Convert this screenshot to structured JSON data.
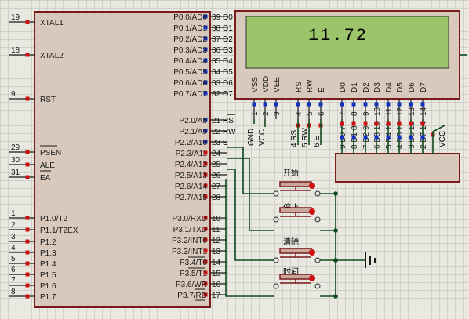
{
  "lcd": {
    "display_text": "11.72"
  },
  "mcu": {
    "left_pins": [
      {
        "num": "19",
        "name": "XTAL1"
      },
      {
        "num": "18",
        "name": "XTAL2"
      },
      {
        "num": "9",
        "name": "RST"
      },
      {
        "num": "29",
        "name": "PSEN"
      },
      {
        "num": "30",
        "name": "ALE"
      },
      {
        "num": "31",
        "name": "EA"
      },
      {
        "num": "1",
        "name": "P1.0/T2"
      },
      {
        "num": "2",
        "name": "P1.1/T2EX"
      },
      {
        "num": "3",
        "name": "P1.2"
      },
      {
        "num": "4",
        "name": "P1.3"
      },
      {
        "num": "5",
        "name": "P1.4"
      },
      {
        "num": "6",
        "name": "P1.5"
      },
      {
        "num": "7",
        "name": "P1.6"
      },
      {
        "num": "8",
        "name": "P1.7"
      }
    ],
    "right_pins": [
      {
        "num": "39",
        "name": "P0.0/AD0",
        "net": "D0"
      },
      {
        "num": "38",
        "name": "P0.1/AD1",
        "net": "D1"
      },
      {
        "num": "37",
        "name": "P0.2/AD2",
        "net": "D2"
      },
      {
        "num": "36",
        "name": "P0.3/AD3",
        "net": "D3"
      },
      {
        "num": "35",
        "name": "P0.4/AD4",
        "net": "D4"
      },
      {
        "num": "34",
        "name": "P0.5/AD5",
        "net": "D5"
      },
      {
        "num": "33",
        "name": "P0.6/AD6",
        "net": "D6"
      },
      {
        "num": "32",
        "name": "P0.7/AD7",
        "net": "D7"
      },
      {
        "num": "21",
        "name": "P2.0/A8",
        "net": "RS"
      },
      {
        "num": "22",
        "name": "P2.1/A9",
        "net": "RW"
      },
      {
        "num": "23",
        "name": "P2.2/A10",
        "net": "E"
      },
      {
        "num": "24",
        "name": "P2.3/A11",
        "net": ""
      },
      {
        "num": "25",
        "name": "P2.4/A12",
        "net": ""
      },
      {
        "num": "26",
        "name": "P2.5/A13",
        "net": ""
      },
      {
        "num": "27",
        "name": "P2.6/A14",
        "net": ""
      },
      {
        "num": "28",
        "name": "P2.7/A15",
        "net": ""
      },
      {
        "num": "10",
        "name": "P3.0/RXD",
        "net": ""
      },
      {
        "num": "11",
        "name": "P3.1/TXD",
        "net": ""
      },
      {
        "num": "12",
        "name": "P3.2/INT0",
        "net": ""
      },
      {
        "num": "13",
        "name": "P3.3/INT1",
        "net": ""
      },
      {
        "num": "14",
        "name": "P3.4/T0",
        "net": ""
      },
      {
        "num": "15",
        "name": "P3.5/T1",
        "net": ""
      },
      {
        "num": "16",
        "name": "P3.6/WR",
        "net": ""
      },
      {
        "num": "17",
        "name": "P3.7/RD",
        "net": ""
      }
    ]
  },
  "lcd_pins": {
    "names": [
      "VSS",
      "VDD",
      "VEE",
      "RS",
      "RW",
      "E",
      "D0",
      "D1",
      "D2",
      "D3",
      "D4",
      "D5",
      "D6",
      "D7"
    ],
    "numbers": [
      "1",
      "2",
      "3",
      "4",
      "5",
      "6",
      "7",
      "8",
      "9",
      "10",
      "11",
      "12",
      "13",
      "14"
    ]
  },
  "lcd_connections": {
    "gnd": "GND",
    "vcc": "VCC",
    "rs": "RS",
    "rw": "RW",
    "e": "E",
    "rs_num": "4",
    "rw_num": "5",
    "e_num": "6"
  },
  "resistor_pack": {
    "pins": [
      "9",
      "8",
      "7",
      "6",
      "5",
      "4",
      "3",
      "2"
    ],
    "labels": [
      "D0",
      "D1",
      "D2",
      "D3",
      "D4",
      "D5",
      "D6",
      "D7"
    ],
    "vcc_label": "VCC",
    "pin_labels": [
      "9 D0 7",
      "8 D1 8",
      "7 D2 9",
      "6 D3 10",
      "5 D4 11",
      "4 D5 12",
      "3 D6 13",
      "2 D7 14"
    ]
  },
  "buttons": [
    {
      "label": "开始"
    },
    {
      "label": "停止"
    },
    {
      "label": "清除"
    },
    {
      "label": "时间"
    }
  ],
  "colors": {
    "chip_fill": "#d8c9bc",
    "chip_border": "#7a1a1a",
    "lcd_screen": "#9cc46a",
    "wire": "#0d4a1d",
    "pin_red": "#d01010",
    "pin_blue": "#1030c0"
  }
}
